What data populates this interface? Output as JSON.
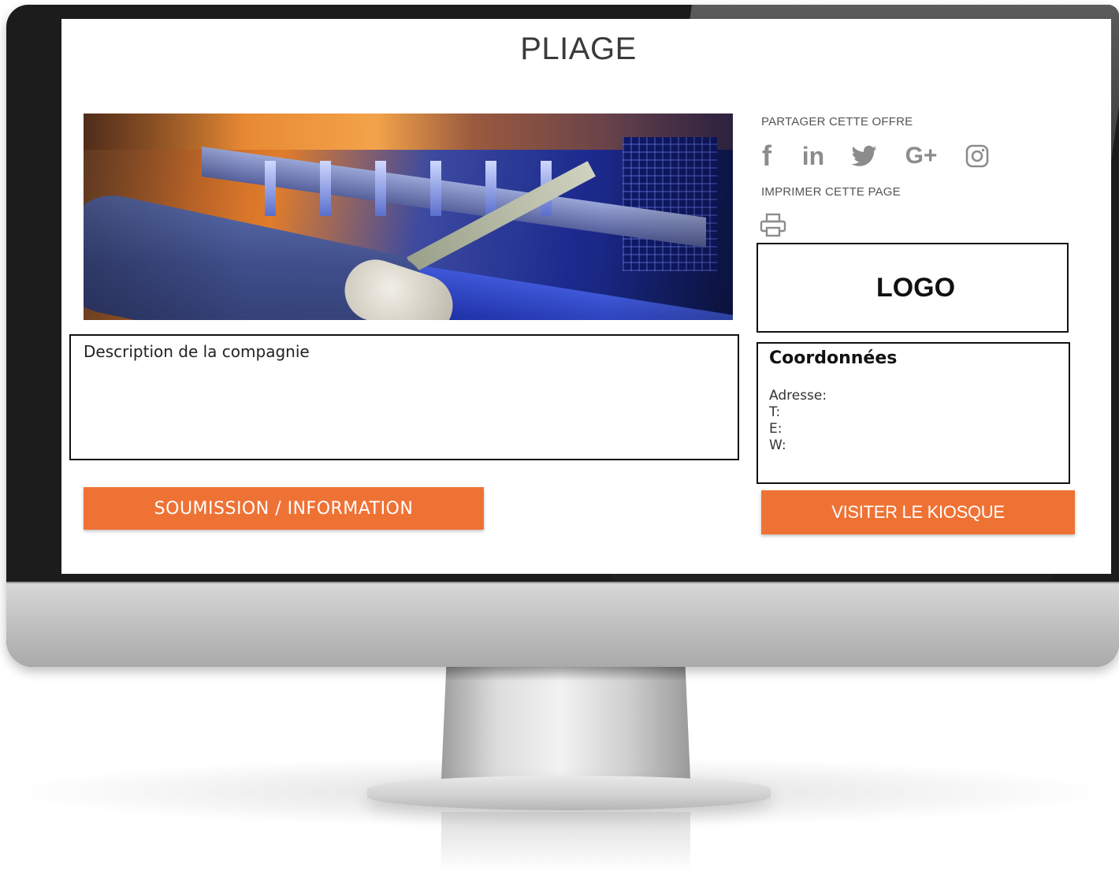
{
  "page": {
    "title": "PLIAGE"
  },
  "share": {
    "label": "PARTAGER CETTE OFFRE",
    "icons": [
      "facebook-icon",
      "linkedin-icon",
      "twitter-icon",
      "google-plus-icon",
      "instagram-icon"
    ],
    "facebook_glyph": "f",
    "linkedin_glyph": "in",
    "googleplus_glyph": "G+"
  },
  "print": {
    "label": "IMPRIMER CETTE PAGE",
    "icon": "printer-icon"
  },
  "logo": {
    "text": "LOGO"
  },
  "description": {
    "title": "Description de la compagnie"
  },
  "contact": {
    "title": "Coordonnées",
    "address_label": "Adresse:",
    "phone_label": "T:",
    "email_label": "E:",
    "web_label": "W:"
  },
  "buttons": {
    "submit_label": "SOUMISSION / INFORMATION",
    "kiosk_label": "VISITER LE KIOSQUE"
  },
  "colors": {
    "accent": "#ef7235",
    "icon_gray": "#8c8c8c",
    "bezel": "#1c1c1c"
  }
}
